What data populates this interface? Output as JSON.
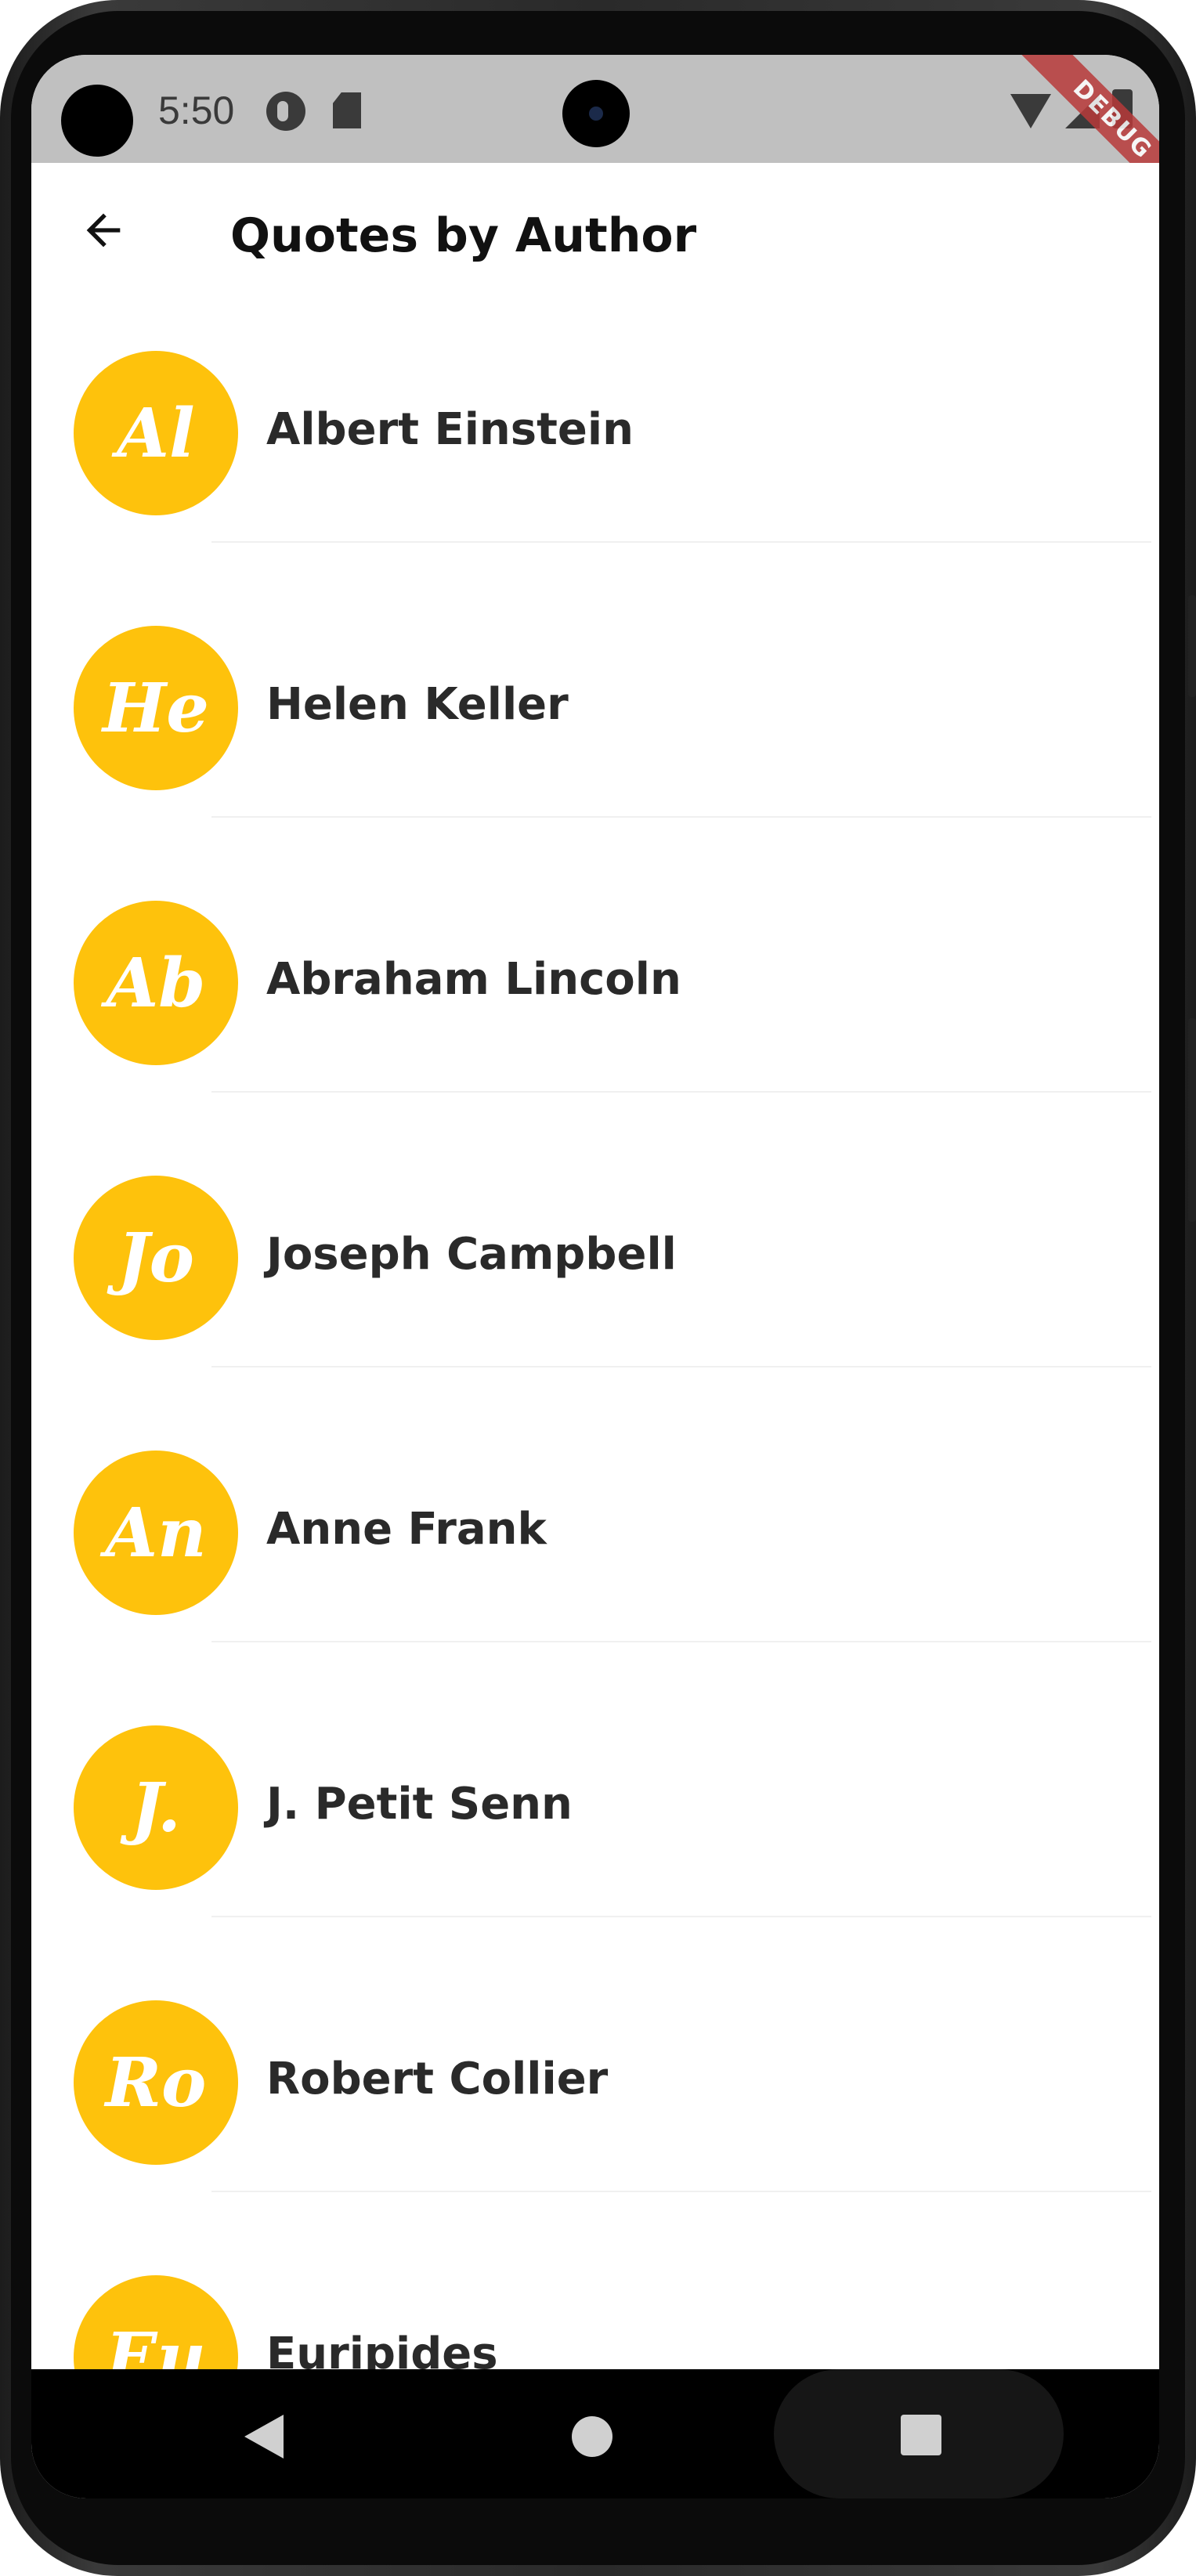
{
  "status_bar": {
    "time": "5:50",
    "icons": [
      "camera-punch-hole",
      "app-notification-icon",
      "sd-card-icon",
      "wifi-icon",
      "cell-signal-icon",
      "battery-icon"
    ],
    "debug_label": "DEBUG"
  },
  "app_bar": {
    "title": "Quotes by Author",
    "back_icon": "arrow-left-icon"
  },
  "authors": [
    {
      "initials": "Al",
      "name": "Albert Einstein"
    },
    {
      "initials": "He",
      "name": "Helen Keller"
    },
    {
      "initials": "Ab",
      "name": "Abraham Lincoln"
    },
    {
      "initials": "Jo",
      "name": "Joseph Campbell"
    },
    {
      "initials": "An",
      "name": "Anne Frank"
    },
    {
      "initials": "J.",
      "name": "J. Petit Senn"
    },
    {
      "initials": "Ro",
      "name": "Robert Collier"
    },
    {
      "initials": "Eu",
      "name": "Euripides"
    }
  ],
  "colors": {
    "avatar_background": "#fec20c",
    "status_bar_background": "#c0c0c0",
    "page_background": "#ffffff",
    "text_primary": "#2a2a2a"
  },
  "nav_bar": {
    "icons": [
      "back-triangle-icon",
      "home-circle-icon",
      "recents-square-icon"
    ]
  }
}
